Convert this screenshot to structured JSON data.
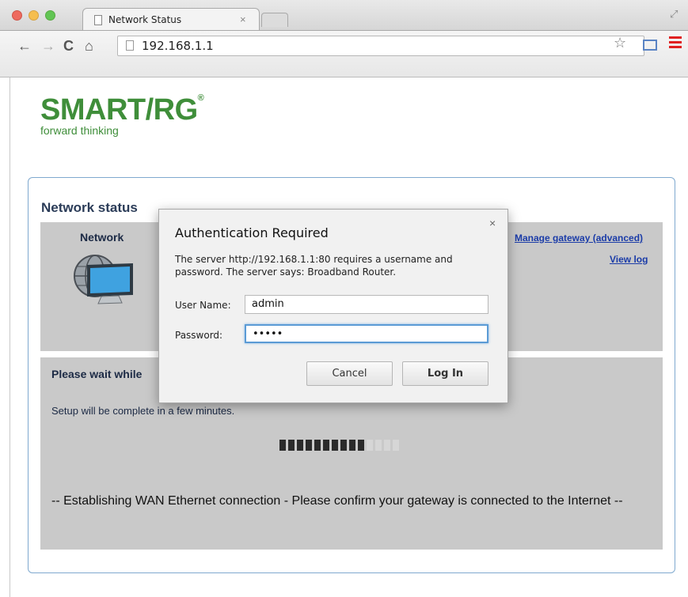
{
  "browser": {
    "tab_title": "Network Status",
    "tab_close": "×",
    "url": "192.168.1.1",
    "icons": [
      "back-arrow-icon",
      "forward-arrow-icon",
      "reload-icon",
      "home-icon",
      "star-icon",
      "menu-icon"
    ]
  },
  "page": {
    "logo_text": "SMART/RG",
    "logo_reg": "®",
    "logo_tagline": "forward thinking",
    "status_title": "Network status",
    "network_label": "Network",
    "manage_link": "Manage gateway (advanced)",
    "view_log_link": "View log",
    "wait_text": "Please wait while",
    "setup_text": "Setup will be complete in a few minutes.",
    "progress": {
      "filled_segments": 10,
      "total_segments": 14
    },
    "wan_text": "-- Establishing WAN Ethernet connection - Please confirm your gateway is connected to the Internet --"
  },
  "dialog": {
    "title": "Authentication Required",
    "message": "The server http://192.168.1.1:80 requires a username and password. The server says: Broadband Router.",
    "user_label": "User Name:",
    "user_value": "admin",
    "password_label": "Password:",
    "password_value": "•••••",
    "cancel_label": "Cancel",
    "login_label": "Log In",
    "close_glyph": "×"
  },
  "colors": {
    "brand_green": "#3f8e3a",
    "link_blue": "#1b3ca8",
    "panel_gray": "#c9c9c9",
    "focus_blue": "#5b9bd5"
  }
}
